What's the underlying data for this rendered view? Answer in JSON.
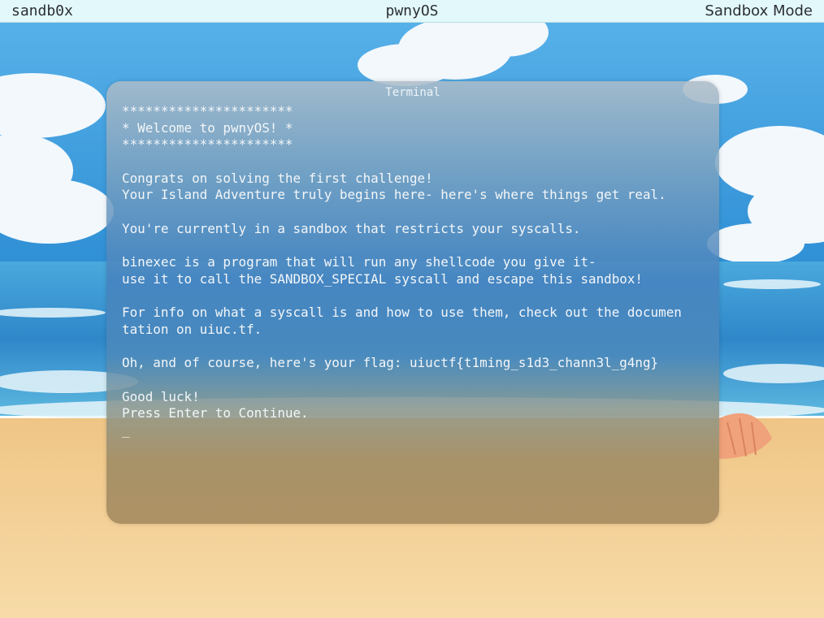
{
  "topbar": {
    "left_label": "sandb0x",
    "center_label": "pwnyOS",
    "right_label": "Sandbox Mode"
  },
  "terminal": {
    "title": "Terminal",
    "lines": [
      "**********************",
      "* Welcome to pwnyOS! *",
      "**********************",
      "",
      "Congrats on solving the first challenge!",
      "Your Island Adventure truly begins here- here's where things get real.",
      "",
      "You're currently in a sandbox that restricts your syscalls.",
      "",
      "binexec is a program that will run any shellcode you give it-",
      "use it to call the SANDBOX_SPECIAL syscall and escape this sandbox!",
      "",
      "For info on what a syscall is and how to use them, check out the documen",
      "tation on uiuc.tf.",
      "",
      "Oh, and of course, here's your flag: uiuctf{t1ming_s1d3_chann3l_g4ng}",
      "",
      "Good luck!",
      "Press Enter to Continue."
    ],
    "cursor": "_"
  },
  "colors": {
    "topbar_bg": "#e3f8fb",
    "terminal_text": "#f3f6f8",
    "sky": "#3f98d8",
    "sea": "#2f87c9",
    "sand": "#f3cf8e"
  },
  "icons": [
    "cloud",
    "seashell"
  ]
}
